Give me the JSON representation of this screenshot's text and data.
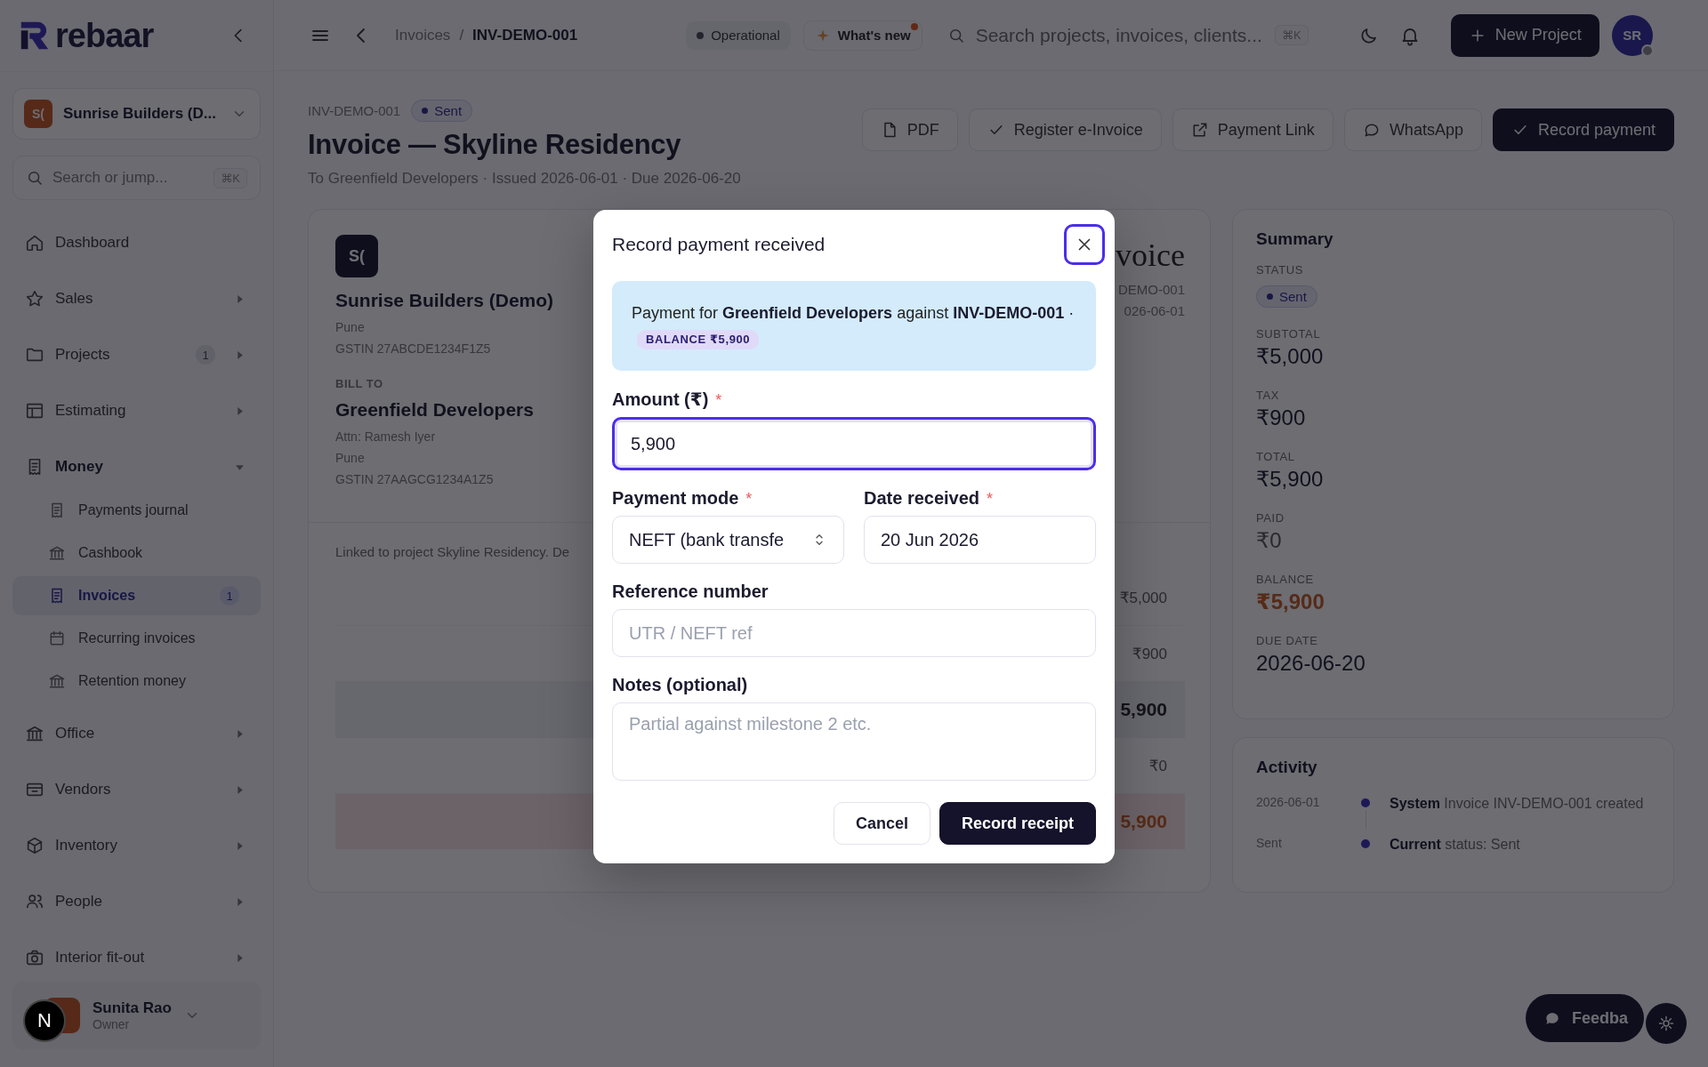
{
  "sidebar": {
    "logo": "rebaar",
    "org": {
      "initials": "S(",
      "name": "Sunrise Builders (D..."
    },
    "search": {
      "placeholder": "Search or jump...",
      "shortcut": "⌘K"
    },
    "nav": [
      {
        "label": "Dashboard"
      },
      {
        "label": "Sales",
        "expanded": false
      },
      {
        "label": "Projects",
        "expanded": false,
        "badge": "1"
      },
      {
        "label": "Estimating",
        "expanded": false
      },
      {
        "label": "Money",
        "expanded": true,
        "children": [
          {
            "label": "Payments journal",
            "selected": false
          },
          {
            "label": "Cashbook",
            "selected": false
          },
          {
            "label": "Invoices",
            "selected": true,
            "badge": "1"
          },
          {
            "label": "Recurring invoices",
            "selected": false
          },
          {
            "label": "Retention money",
            "selected": false
          }
        ]
      },
      {
        "label": "Office",
        "expanded": false
      },
      {
        "label": "Vendors",
        "expanded": false
      },
      {
        "label": "Inventory",
        "expanded": false
      },
      {
        "label": "People",
        "expanded": false
      },
      {
        "label": "Interior fit-out",
        "expanded": false
      }
    ],
    "user": {
      "name": "Sunita Rao",
      "role": "Owner"
    }
  },
  "dev_badge": "N",
  "topbar": {
    "breadcrumb": [
      {
        "label": "Invoices",
        "current": false
      },
      {
        "label": "INV-DEMO-001",
        "current": true
      }
    ],
    "separator": "/",
    "status": "Operational",
    "whats_new": {
      "label": "What's new",
      "unread": true
    },
    "search": {
      "placeholder": "Search projects, invoices, clients...",
      "shortcut": "⌘K"
    },
    "new_project": "New Project",
    "avatar": {
      "initials": "SR",
      "online": true
    }
  },
  "header": {
    "id": "INV-DEMO-001",
    "status": "Sent",
    "title": "Invoice — Skyline Residency",
    "subtitle": "To Greenfield Developers · Issued 2026-06-01 · Due 2026-06-20",
    "actions": [
      {
        "label": "PDF",
        "primary": false
      },
      {
        "label": "Register e-Invoice",
        "primary": false
      },
      {
        "label": "Payment Link",
        "primary": false
      },
      {
        "label": "WhatsApp",
        "primary": false
      },
      {
        "label": "Record payment",
        "primary": true
      }
    ]
  },
  "invoice": {
    "from": {
      "initials": "S(",
      "name": "Sunrise Builders (Demo)",
      "lines": [
        "Pune",
        "GSTIN 27ABCDE1234F1Z5"
      ]
    },
    "bill_to": {
      "heading": "BILL TO",
      "name": "Greenfield Developers",
      "lines": [
        "Attn: Ramesh Iyer",
        "Pune",
        "GSTIN 27AAGCG1234A1Z5"
      ]
    },
    "doc": {
      "title": "voice",
      "lines": [
        "DEMO-001",
        "026-06-01"
      ]
    },
    "note": "Linked to project Skyline Residency. De",
    "rows": [
      {
        "kind": "line",
        "value": "₹5,000"
      },
      {
        "kind": "line",
        "value": "₹900"
      },
      {
        "kind": "total",
        "value": "5,900"
      },
      {
        "kind": "line",
        "value": "₹0"
      },
      {
        "kind": "balance",
        "value": "5,900"
      }
    ]
  },
  "summary": {
    "title": "Summary",
    "items": [
      {
        "label": "STATUS",
        "kind": "badge",
        "value": "Sent"
      },
      {
        "label": "SUBTOTAL",
        "kind": "amount",
        "muted": false,
        "highlighted": false,
        "value": "₹5,000"
      },
      {
        "label": "TAX",
        "kind": "amount",
        "muted": false,
        "highlighted": false,
        "value": "₹900"
      },
      {
        "label": "TOTAL",
        "kind": "amount",
        "muted": false,
        "highlighted": false,
        "value": "₹5,900"
      },
      {
        "label": "PAID",
        "kind": "amount",
        "muted": true,
        "highlighted": false,
        "value": "₹0"
      },
      {
        "label": "BALANCE",
        "kind": "amount",
        "muted": false,
        "highlighted": true,
        "value": "₹5,900"
      },
      {
        "label": "DUE DATE",
        "kind": "amount",
        "muted": false,
        "highlighted": false,
        "value": "2026-06-20"
      }
    ]
  },
  "activity": {
    "title": "Activity",
    "entries": [
      {
        "when": "2026-06-01",
        "text": "**System** Invoice INV-DEMO-001 created"
      },
      {
        "when": "Sent",
        "text": "**Current** status: Sent"
      }
    ]
  },
  "modal": {
    "title": "Record payment received",
    "close_focused": true,
    "info": {
      "text": "Payment for **Greenfield Developers** against **INV-DEMO-001** ·",
      "badge": "BALANCE ₹5,900"
    },
    "field_rows": [
      [
        {
          "kind": "input",
          "label": "Amount (₹)",
          "required_mark": "*",
          "value": "5,900",
          "focused": true
        }
      ],
      [
        {
          "kind": "select",
          "label": "Payment mode",
          "required_mark": "*",
          "value": "NEFT (bank transfe",
          "focused": false
        },
        {
          "kind": "input",
          "label": "Date received",
          "required_mark": "*",
          "value": "20 Jun 2026",
          "focused": false
        }
      ],
      [
        {
          "kind": "input",
          "label": "Reference number",
          "placeholder": "UTR / NEFT ref",
          "focused": false
        }
      ],
      [
        {
          "kind": "textarea",
          "label": "Notes (optional)",
          "placeholder": "Partial against milestone 2 etc.",
          "focused": false
        }
      ]
    ],
    "buttons": [
      {
        "label": "Cancel",
        "primary": false
      },
      {
        "label": "Record receipt",
        "primary": true
      }
    ]
  },
  "feedback": "Feedba"
}
